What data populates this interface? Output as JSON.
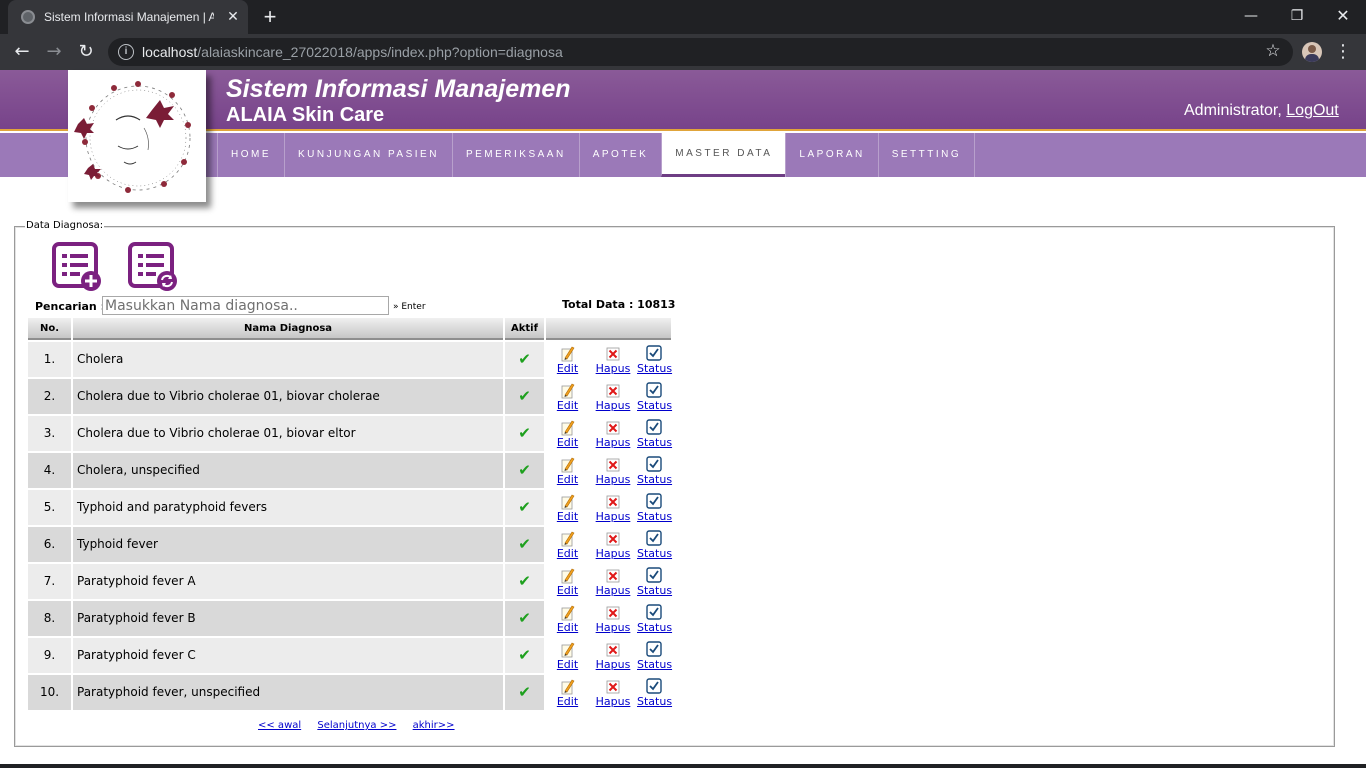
{
  "browser": {
    "tab_title": "Sistem Informasi Manajemen | AL",
    "url_host": "localhost",
    "url_path": "/alaiaskincare_27022018/apps/index.php?option=diagnosa"
  },
  "header": {
    "title": "Sistem Informasi Manajemen",
    "subtitle": "ALAIA Skin Care",
    "user": "Administrator,",
    "logout": "LogOut",
    "menu": [
      "HOME",
      "KUNJUNGAN PASIEN",
      "PEMERIKSAAN",
      "APOTEK",
      "MASTER DATA",
      "LAPORAN",
      "SETTTING"
    ],
    "active_menu": "MASTER DATA",
    "colors": {
      "header": "#7f4a92",
      "nav": "#9b79b8",
      "accent": "#e0a43a"
    }
  },
  "content": {
    "legend": "Data Diagnosa:",
    "search_label": "Pencarian :",
    "search_placeholder": "Masukkan Nama diagnosa..",
    "search_hint": "» Enter",
    "total": "Total Data : 10813",
    "columns": {
      "no": "No.",
      "name": "Nama Diagnosa",
      "aktif": "Aktif"
    },
    "actions": {
      "edit": "Edit",
      "hapus": "Hapus",
      "status": "Status"
    },
    "rows": [
      {
        "no": "1.",
        "name": "Cholera"
      },
      {
        "no": "2.",
        "name": "Cholera due to Vibrio cholerae 01, biovar cholerae"
      },
      {
        "no": "3.",
        "name": "Cholera due to Vibrio cholerae 01, biovar eltor"
      },
      {
        "no": "4.",
        "name": "Cholera, unspecified"
      },
      {
        "no": "5.",
        "name": "Typhoid and paratyphoid fevers"
      },
      {
        "no": "6.",
        "name": "Typhoid fever"
      },
      {
        "no": "7.",
        "name": "Paratyphoid fever A"
      },
      {
        "no": "8.",
        "name": "Paratyphoid fever B"
      },
      {
        "no": "9.",
        "name": "Paratyphoid fever C"
      },
      {
        "no": "10.",
        "name": "Paratyphoid fever, unspecified"
      }
    ],
    "pager": {
      "first": "<< awal",
      "next": "Selanjutnya >>",
      "last": "akhir>>"
    }
  }
}
